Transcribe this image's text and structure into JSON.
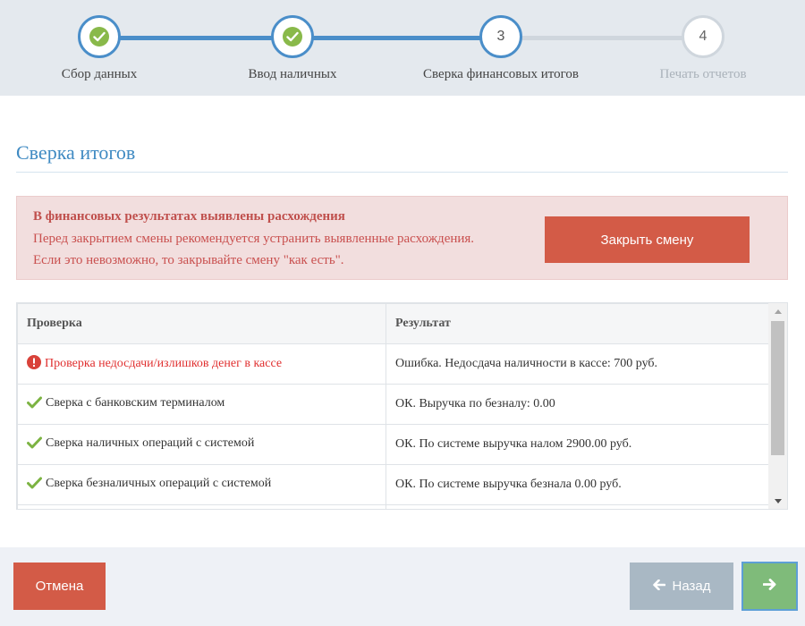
{
  "stepper": {
    "steps": [
      {
        "label": "Сбор данных",
        "state": "done"
      },
      {
        "label": "Ввод наличных",
        "state": "done"
      },
      {
        "number": "3",
        "label": "Сверка финансовых итогов",
        "state": "current"
      },
      {
        "number": "4",
        "label": "Печать отчетов",
        "state": "pending"
      }
    ]
  },
  "section": {
    "title": "Сверка итогов"
  },
  "alert": {
    "title": "В финансовых результатах выявлены расхождения",
    "line1": "Перед закрытием смены рекомендуется устранить выявленные расхождения.",
    "line2": "Если это невозможно, то закрывайте смену \"как есть\".",
    "button_label": "Закрыть смену"
  },
  "table": {
    "headers": [
      "Проверка",
      "Результат"
    ],
    "rows": [
      {
        "status": "error",
        "icon": "exclamation-circle-icon",
        "check": "Проверка недосдачи/излишков денег в кассе",
        "result": "Ошибка. Недосдача наличности в кассе: 700 руб."
      },
      {
        "status": "ok",
        "icon": "checkmark-icon",
        "check": "Сверка с банковским терминалом",
        "result": "ОК. Выручка по безналу: 0.00"
      },
      {
        "status": "ok",
        "icon": "checkmark-icon",
        "check": "Сверка наличных операций с системой",
        "result": "ОК. По системе выручка налом 2900.00 руб."
      },
      {
        "status": "ok",
        "icon": "checkmark-icon",
        "check": "Сверка безналичных операций с системой",
        "result": "ОК. По системе выручка безнала 0.00 руб."
      }
    ]
  },
  "footer": {
    "cancel_label": "Отмена",
    "back_label": "Назад"
  },
  "colors": {
    "accent_blue": "#4a8ec9",
    "danger": "#d35b47",
    "success": "#89b94a",
    "error_text": "#e03030"
  }
}
